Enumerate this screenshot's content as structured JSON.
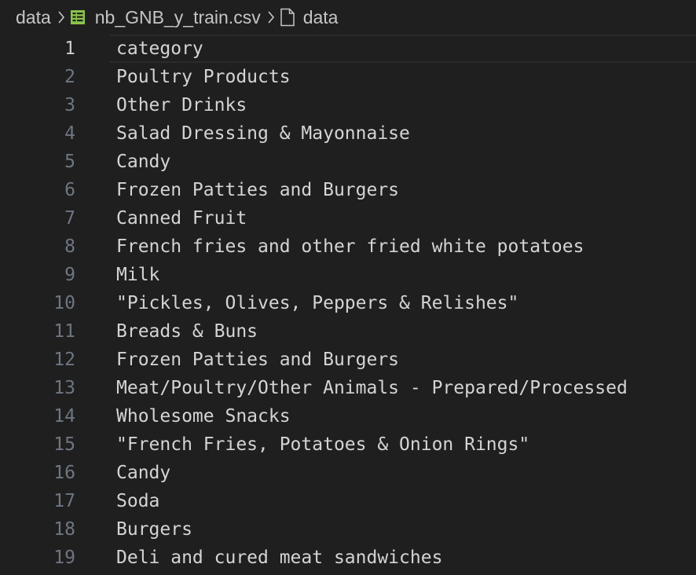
{
  "breadcrumb": {
    "folder": "data",
    "file": "nb_GNB_y_train.csv",
    "symbol": "data",
    "separator_icon": "chevron-right-icon",
    "file_icon": "csv-table-icon",
    "symbol_icon": "file-icon"
  },
  "colors": {
    "background": "#1f1f1f",
    "text": "#d4d4d4",
    "line_number": "#6e7681",
    "active_line_number": "#cccccc",
    "csv_icon": "#8bc34a"
  },
  "editor": {
    "current_line": 1,
    "lines": [
      {
        "num": "1",
        "text": "category"
      },
      {
        "num": "2",
        "text": "Poultry Products"
      },
      {
        "num": "3",
        "text": "Other Drinks"
      },
      {
        "num": "4",
        "text": "Salad Dressing & Mayonnaise"
      },
      {
        "num": "5",
        "text": "Candy"
      },
      {
        "num": "6",
        "text": "Frozen Patties and Burgers"
      },
      {
        "num": "7",
        "text": "Canned Fruit"
      },
      {
        "num": "8",
        "text": "French fries and other fried white potatoes"
      },
      {
        "num": "9",
        "text": "Milk"
      },
      {
        "num": "10",
        "text": "\"Pickles, Olives, Peppers & Relishes\""
      },
      {
        "num": "11",
        "text": "Breads & Buns"
      },
      {
        "num": "12",
        "text": "Frozen Patties and Burgers"
      },
      {
        "num": "13",
        "text": "Meat/Poultry/Other Animals - Prepared/Processed"
      },
      {
        "num": "14",
        "text": "Wholesome Snacks"
      },
      {
        "num": "15",
        "text": "\"French Fries, Potatoes & Onion Rings\""
      },
      {
        "num": "16",
        "text": "Candy"
      },
      {
        "num": "17",
        "text": "Soda"
      },
      {
        "num": "18",
        "text": "Burgers"
      },
      {
        "num": "19",
        "text": "Deli and cured meat sandwiches"
      }
    ]
  }
}
